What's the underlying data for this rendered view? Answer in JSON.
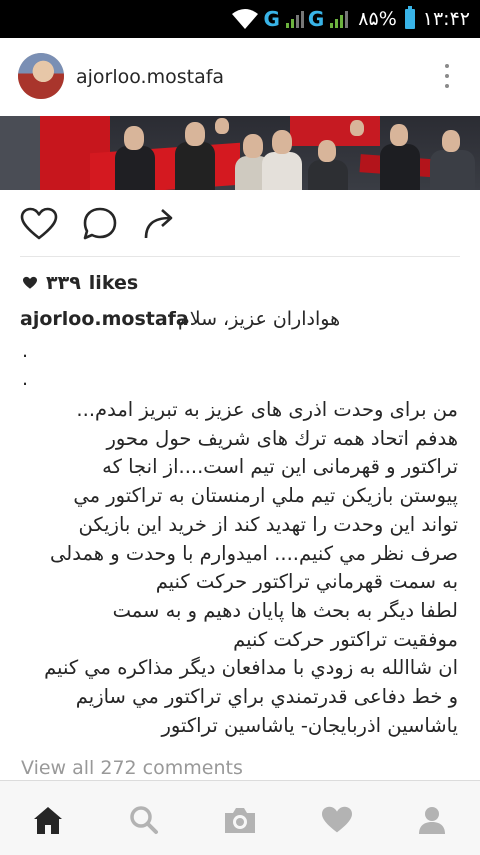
{
  "status_bar": {
    "network_1": "G",
    "network_2": "G",
    "battery": "۸۵%",
    "time": "۱۳:۴۲"
  },
  "post": {
    "username": "ajorloo.mostafa",
    "likes_count": "۳۳۹",
    "likes_label": "likes",
    "caption_user": "ajorloo.mostafa",
    "caption_greeting": "هواداران عزيز، سلام",
    "dot_lines": [
      ".",
      "."
    ],
    "body_lines": [
      "من براى وحدت اذرى هاى عزيز به تبريز امدم...",
      "هدفم اتحاد همه ترك هاى شريف حول محور",
      "تراكتور و قهرمانى اين تيم است....از انجا كه",
      "پيوستن بازيكن تيم ملي ارمنستان به تراكتور مي",
      "تواند اين وحدت را تهديد كند از خريد اين بازيكن",
      "صرف نظر مي كنيم.... اميدوارم با وحدت و همدلى",
      "به سمت قهرماني تراكتور حركت كنيم",
      "لطفا ديگر به بحث ها پايان دهيم و به سمت",
      "موفقيت تراكتور حركت كنيم",
      "ان شاالله به زودي با مدافعان ديگر مذاكره مي كنيم",
      "و خط دفاعى قدرتمندي براي تراكتور مي سازيم",
      "ياشاسين اذربايجان- ياشاسين تراكتور"
    ],
    "view_all_comments": "View all 272 comments"
  },
  "icons": {
    "like": "heart-outline-icon",
    "comment": "comment-bubble-icon",
    "share": "share-arrow-icon",
    "more": "vertical-ellipsis-icon",
    "nav": [
      "home-icon",
      "search-icon",
      "camera-icon",
      "heart-icon",
      "profile-icon"
    ]
  },
  "colors": {
    "text": "#262626",
    "muted": "#999999",
    "status_blue": "#39b4e8",
    "status_green": "#6db33f",
    "nav_active": "#262626",
    "nav_inactive": "#b3b3b3"
  }
}
